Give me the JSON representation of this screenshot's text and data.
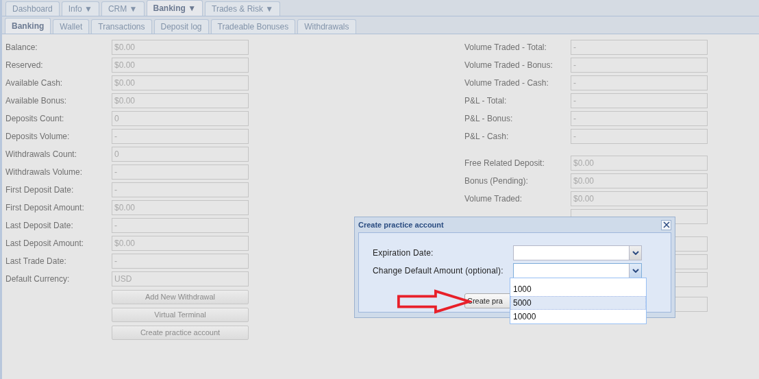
{
  "main_tabs": [
    {
      "label": "Dashboard",
      "selected": false
    },
    {
      "label": "Info ▼",
      "selected": false
    },
    {
      "label": "CRM ▼",
      "selected": false
    },
    {
      "label": "Banking ▼",
      "selected": true
    },
    {
      "label": "Trades & Risk ▼",
      "selected": false
    }
  ],
  "sub_tabs": [
    {
      "label": "Banking",
      "selected": true
    },
    {
      "label": "Wallet",
      "selected": false
    },
    {
      "label": "Transactions",
      "selected": false
    },
    {
      "label": "Deposit log",
      "selected": false
    },
    {
      "label": "Tradeable Bonuses",
      "selected": false
    },
    {
      "label": "Withdrawals",
      "selected": false
    }
  ],
  "left_fields": [
    {
      "label": "Balance:",
      "value": "$0.00"
    },
    {
      "label": "Reserved:",
      "value": "$0.00"
    },
    {
      "label": "Available Cash:",
      "value": "$0.00"
    },
    {
      "label": "Available Bonus:",
      "value": "$0.00"
    },
    {
      "label": "Deposits Count:",
      "value": "0"
    },
    {
      "label": "Deposits Volume:",
      "value": "-"
    },
    {
      "label": "Withdrawals Count:",
      "value": "0"
    },
    {
      "label": "Withdrawals Volume:",
      "value": "-"
    },
    {
      "label": "First Deposit Date:",
      "value": "-"
    },
    {
      "label": "First Deposit Amount:",
      "value": "$0.00"
    },
    {
      "label": "Last Deposit Date:",
      "value": "-"
    },
    {
      "label": "Last Deposit Amount:",
      "value": "$0.00"
    },
    {
      "label": "Last Trade Date:",
      "value": "-"
    },
    {
      "label": "Default Currency:",
      "value": "USD"
    }
  ],
  "left_buttons": [
    "Add New Withdrawal",
    "Virtual Terminal",
    "Create practice account"
  ],
  "right_fields_top": [
    {
      "label": "Volume Traded - Total:",
      "value": "-"
    },
    {
      "label": "Volume Traded - Bonus:",
      "value": "-"
    },
    {
      "label": "Volume Traded - Cash:",
      "value": "-"
    },
    {
      "label": "P&L - Total:",
      "value": "-"
    },
    {
      "label": "P&L - Bonus:",
      "value": "-"
    },
    {
      "label": "P&L - Cash:",
      "value": "-"
    }
  ],
  "right_fields_bottom": [
    {
      "label": "Free Related Deposit:",
      "value": "$0.00"
    },
    {
      "label": "Bonus (Pending):",
      "value": "$0.00"
    },
    {
      "label": "Volume Traded:",
      "value": "$0.00"
    }
  ],
  "dialog": {
    "title": "Create practice account",
    "fields": [
      {
        "label": "Expiration Date:",
        "focused": false
      },
      {
        "label": "Change Default Amount (optional):",
        "focused": true
      }
    ],
    "button": "Create pra",
    "options": [
      {
        "label": "1000",
        "selected": false
      },
      {
        "label": "5000",
        "selected": true
      },
      {
        "label": "10000",
        "selected": false
      }
    ]
  }
}
